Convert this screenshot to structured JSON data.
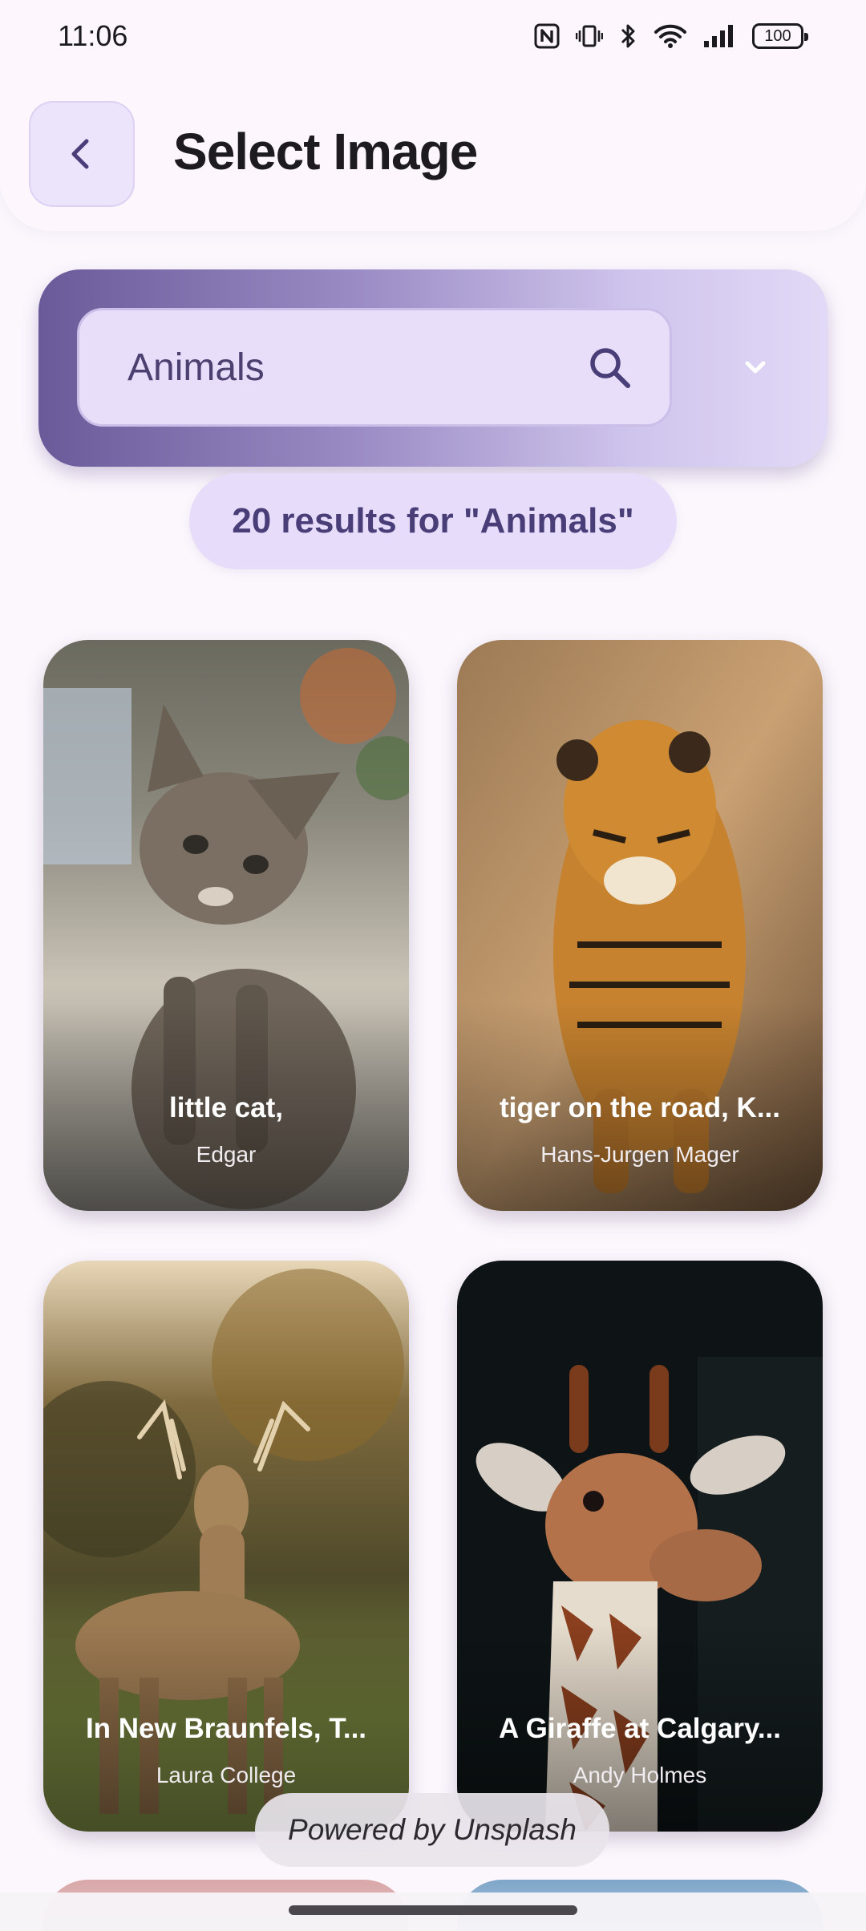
{
  "status_bar": {
    "time": "11:06",
    "battery": "100",
    "icons": [
      "nfc-icon",
      "vibrate-icon",
      "bluetooth-icon",
      "wifi-icon",
      "signal-icon",
      "battery-icon"
    ]
  },
  "header": {
    "title": "Select Image",
    "back_icon": "chevron-left-icon"
  },
  "search": {
    "value": "Animals",
    "search_icon": "search-icon",
    "dropdown_icon": "chevron-down-icon"
  },
  "results": {
    "summary": "20 results for \"Animals\""
  },
  "images": [
    {
      "title": "little cat,",
      "author": "Edgar"
    },
    {
      "title": "tiger on the road, K...",
      "author": "Hans-Jurgen Mager"
    },
    {
      "title": "In New Braunfels, T...",
      "author": "Laura College"
    },
    {
      "title": "A Giraffe at Calgary...",
      "author": "Andy Holmes"
    }
  ],
  "footer": {
    "powered_by": "Powered by Unsplash"
  },
  "colors": {
    "accent": "#6a5a99",
    "chip": "#e7ddfa",
    "background": "#fcf7fd"
  }
}
